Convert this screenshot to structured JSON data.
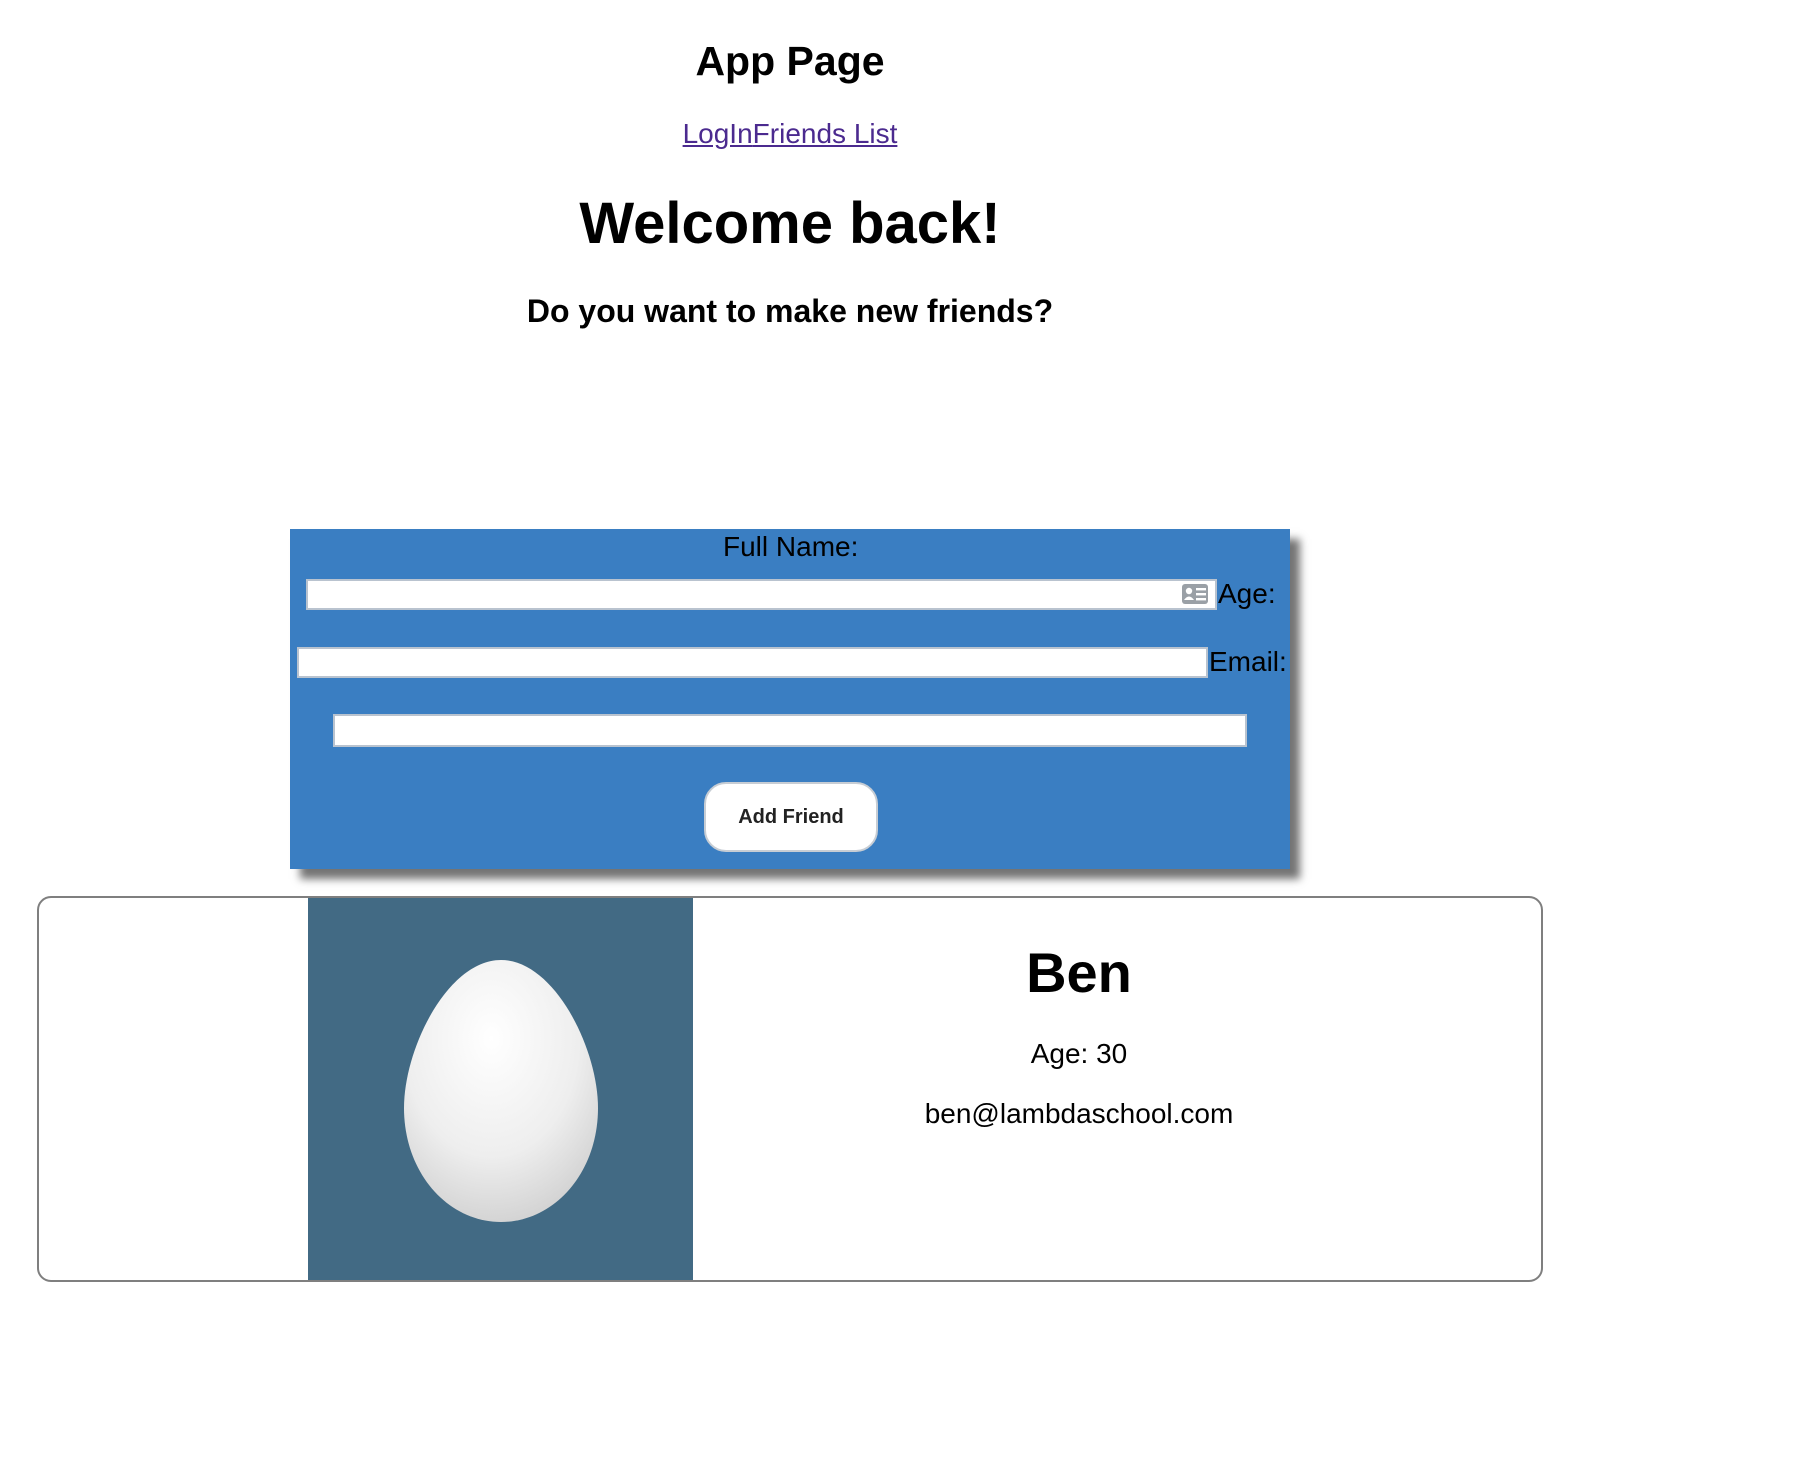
{
  "header": {
    "title": "App Page",
    "nav": {
      "login_link": "LogIn",
      "friends_link": "Friends List"
    }
  },
  "main": {
    "welcome": "Welcome back!",
    "subtitle": "Do you want to make new friends?"
  },
  "form": {
    "full_name_label": "Full Name:",
    "full_name_value": "",
    "age_label": "Age:",
    "age_value": "",
    "email_label": "Email:",
    "email_value": "",
    "submit_label": "Add Friend",
    "panel_color": "#3a7ec2"
  },
  "friends": [
    {
      "name": "Ben",
      "age_text": "Age: 30",
      "email": "ben@lambdaschool.com",
      "avatar_icon": "egg-avatar-icon",
      "avatar_bg": "#426a84"
    }
  ]
}
